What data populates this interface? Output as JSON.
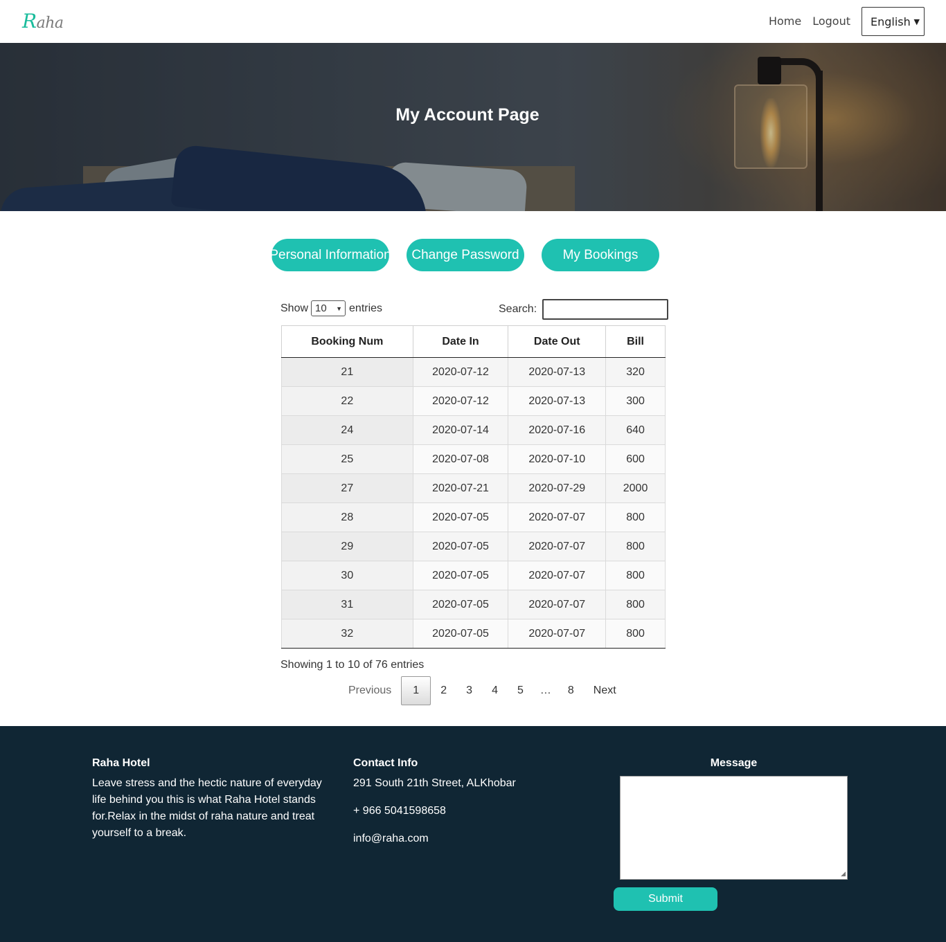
{
  "navbar": {
    "logo_first": "R",
    "logo_rest": "aha",
    "links": [
      {
        "label": "Home"
      },
      {
        "label": "Logout"
      }
    ],
    "language": {
      "selected": "English"
    }
  },
  "hero": {
    "title": "My Account Page"
  },
  "account_tabs": [
    {
      "label": "Personal Information"
    },
    {
      "label": "Change Password"
    },
    {
      "label": "My Bookings"
    }
  ],
  "table_controls": {
    "show_label": "Show",
    "entries_value": "10",
    "entries_label": "entries",
    "search_label": "Search:",
    "search_value": ""
  },
  "bookings": {
    "columns": [
      "Booking Num",
      "Date In",
      "Date Out",
      "Bill"
    ],
    "rows": [
      [
        "21",
        "2020-07-12",
        "2020-07-13",
        "320"
      ],
      [
        "22",
        "2020-07-12",
        "2020-07-13",
        "300"
      ],
      [
        "24",
        "2020-07-14",
        "2020-07-16",
        "640"
      ],
      [
        "25",
        "2020-07-08",
        "2020-07-10",
        "600"
      ],
      [
        "27",
        "2020-07-21",
        "2020-07-29",
        "2000"
      ],
      [
        "28",
        "2020-07-05",
        "2020-07-07",
        "800"
      ],
      [
        "29",
        "2020-07-05",
        "2020-07-07",
        "800"
      ],
      [
        "30",
        "2020-07-05",
        "2020-07-07",
        "800"
      ],
      [
        "31",
        "2020-07-05",
        "2020-07-07",
        "800"
      ],
      [
        "32",
        "2020-07-05",
        "2020-07-07",
        "800"
      ]
    ],
    "info": "Showing 1 to 10 of 76 entries"
  },
  "pagination": {
    "previous": "Previous",
    "pages": [
      "1",
      "2",
      "3",
      "4",
      "5",
      "…",
      "8"
    ],
    "current": "1",
    "next": "Next"
  },
  "footer": {
    "about": {
      "heading": "Raha Hotel",
      "text": "Leave stress and the hectic nature of everyday life behind you this is what Raha Hotel stands for.Relax in the midst of raha nature and treat yourself to a break."
    },
    "contact": {
      "heading": "Contact Info",
      "address": "291 South 21th Street, ALKhobar",
      "phone": "+ 966 5041598658",
      "email": "info@raha.com"
    },
    "message": {
      "label": "Message",
      "value": "",
      "submit_label": "Submit"
    }
  },
  "colors": {
    "accent": "#1fc1b1",
    "footer_bg": "#102634"
  }
}
